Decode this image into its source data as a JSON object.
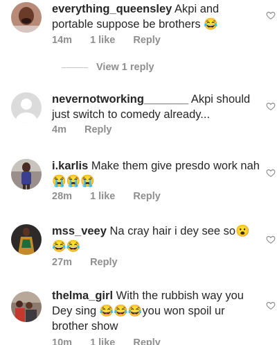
{
  "comments": [
    {
      "username": "everything_queensley",
      "text": "Akpi and portable suppose be brothers 😂",
      "time": "14m",
      "likes": "1 like",
      "reply": "Reply",
      "avatar": "avatar-photo-woman"
    },
    {
      "username": "nevernotworking_______",
      "text": "Akpi should just switch to comedy already...",
      "time": "4m",
      "likes": "",
      "reply": "Reply",
      "avatar": "default-avatar"
    },
    {
      "username": "i.karlis",
      "text": "Make them give presdo work nah 😭😭😭",
      "time": "28m",
      "likes": "1 like",
      "reply": "Reply",
      "avatar": "avatar-photo-woman-standing"
    },
    {
      "username": "mss_veey",
      "text": "Na cray hair i dey see so😮😂😂",
      "time": "27m",
      "likes": "",
      "reply": "Reply",
      "avatar": "avatar-photo-woman-dress"
    },
    {
      "username": "thelma_girl",
      "text": "With the rubbish way you Dey sing 😂😂😂you won spoil ur brother show",
      "time": "10m",
      "likes": "1 like",
      "reply": "Reply",
      "avatar": "avatar-photo-group"
    }
  ],
  "view_replies": "View 1 reply",
  "colors": {
    "text": "#262626",
    "meta": "#8e8e8e",
    "heart": "#8e8e8e"
  }
}
